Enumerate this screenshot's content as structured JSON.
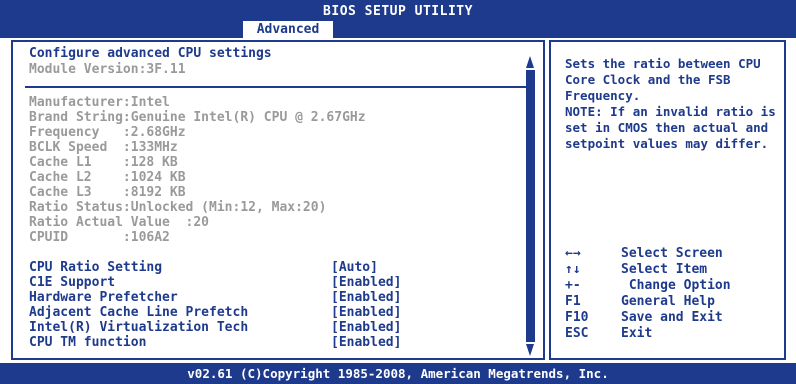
{
  "header": {
    "title": "BIOS SETUP UTILITY",
    "active_tab": "Advanced"
  },
  "main": {
    "heading": "Configure advanced CPU settings",
    "module_version": "Module Version:3F.11",
    "info": [
      "Manufacturer:Intel",
      "Brand String:Genuine Intel(R) CPU @ 2.67GHz",
      "Frequency   :2.68GHz",
      "BCLK Speed  :133MHz",
      "Cache L1    :128 KB",
      "Cache L2    :1024 KB",
      "Cache L3    :8192 KB",
      "Ratio Status:Unlocked (Min:12, Max:20)",
      "Ratio Actual Value  :20",
      "CPUID       :106A2"
    ],
    "settings": [
      {
        "label": "CPU Ratio Setting",
        "value": "[Auto]"
      },
      {
        "label": "C1E Support",
        "value": "[Enabled]"
      },
      {
        "label": "Hardware Prefetcher",
        "value": "[Enabled]"
      },
      {
        "label": "Adjacent Cache Line Prefetch",
        "value": "[Enabled]"
      },
      {
        "label": "Intel(R) Virtualization Tech",
        "value": "[Enabled]"
      },
      {
        "label": "CPU TM function",
        "value": "[Enabled]"
      }
    ]
  },
  "help": {
    "text": "Sets the ratio between CPU Core Clock and the FSB Frequency.\nNOTE: If an invalid ratio is set in CMOS then actual and setpoint values may differ."
  },
  "legend": [
    {
      "key": "←→",
      "action": "Select Screen"
    },
    {
      "key": "↑↓",
      "action": "Select Item"
    },
    {
      "key": "+-",
      "action": " Change Option"
    },
    {
      "key": "F1",
      "action": "General Help"
    },
    {
      "key": "F10",
      "action": "Save and Exit"
    },
    {
      "key": "ESC",
      "action": "Exit"
    }
  ],
  "footer": {
    "copyright": "v02.61 (C)Copyright 1985-2008, American Megatrends, Inc."
  },
  "colors": {
    "bios_blue": "#1e3a8c",
    "gray_text": "#9a9a9a",
    "background": "#ffffff"
  }
}
